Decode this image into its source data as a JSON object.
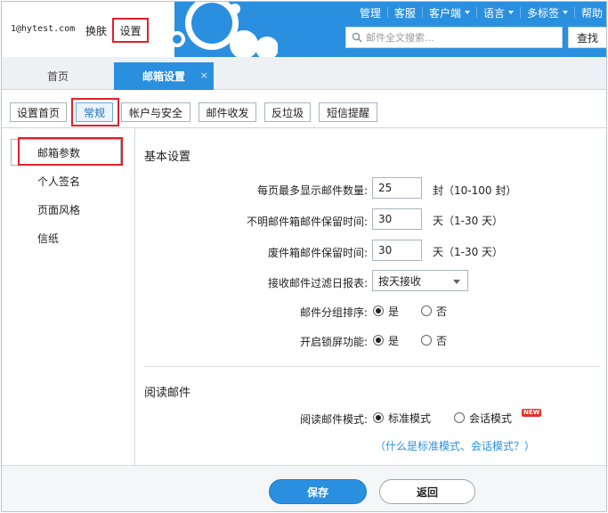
{
  "header": {
    "user_email": "1@hytest.com",
    "skin_label": "换肤",
    "settings_label": "设置",
    "nav": [
      {
        "label": "管理",
        "dropdown": false
      },
      {
        "label": "客服",
        "dropdown": false
      },
      {
        "label": "客户端",
        "dropdown": true
      },
      {
        "label": "语言",
        "dropdown": true
      },
      {
        "label": "多标签",
        "dropdown": true
      },
      {
        "label": "帮助",
        "dropdown": false
      }
    ],
    "search_placeholder": "邮件全文搜索...",
    "search_button": "查找"
  },
  "main_tabs": {
    "home": "首页",
    "mail_settings": "邮箱设置",
    "close_glyph": "×"
  },
  "sub_tabs": [
    "设置首页",
    "常规",
    "帐户与安全",
    "邮件收发",
    "反垃圾",
    "短信提醒"
  ],
  "sub_tab_active": "常规",
  "sidebar": {
    "items": [
      "邮箱参数",
      "个人签名",
      "页面风格",
      "信纸"
    ],
    "active": "邮箱参数"
  },
  "basic": {
    "title": "基本设置",
    "per_page_label": "每页最多显示邮件数量:",
    "per_page_value": "25",
    "per_page_hint": "封（10-100 封）",
    "unknown_label": "不明邮件箱邮件保留时间:",
    "unknown_value": "30",
    "unknown_hint": "天（1-30 天）",
    "trash_label": "废件箱邮件保留时间:",
    "trash_value": "30",
    "trash_hint": "天（1-30 天）",
    "filter_label": "接收邮件过滤日报表:",
    "filter_value": "按天接收",
    "group_label": "邮件分组排序:",
    "lock_label": "开启锁屏功能:",
    "yes": "是",
    "no": "否"
  },
  "reading": {
    "title": "阅读邮件",
    "mode_label": "阅读邮件模式:",
    "standard": "标准模式",
    "conversation": "会话模式",
    "new_badge": "NEW",
    "help_link": "（什么是标准模式、会话模式？）"
  },
  "footer": {
    "save": "保存",
    "back": "返回"
  },
  "colors": {
    "brand_blue": "#2b8fe0",
    "highlight_red": "#e0202a"
  }
}
